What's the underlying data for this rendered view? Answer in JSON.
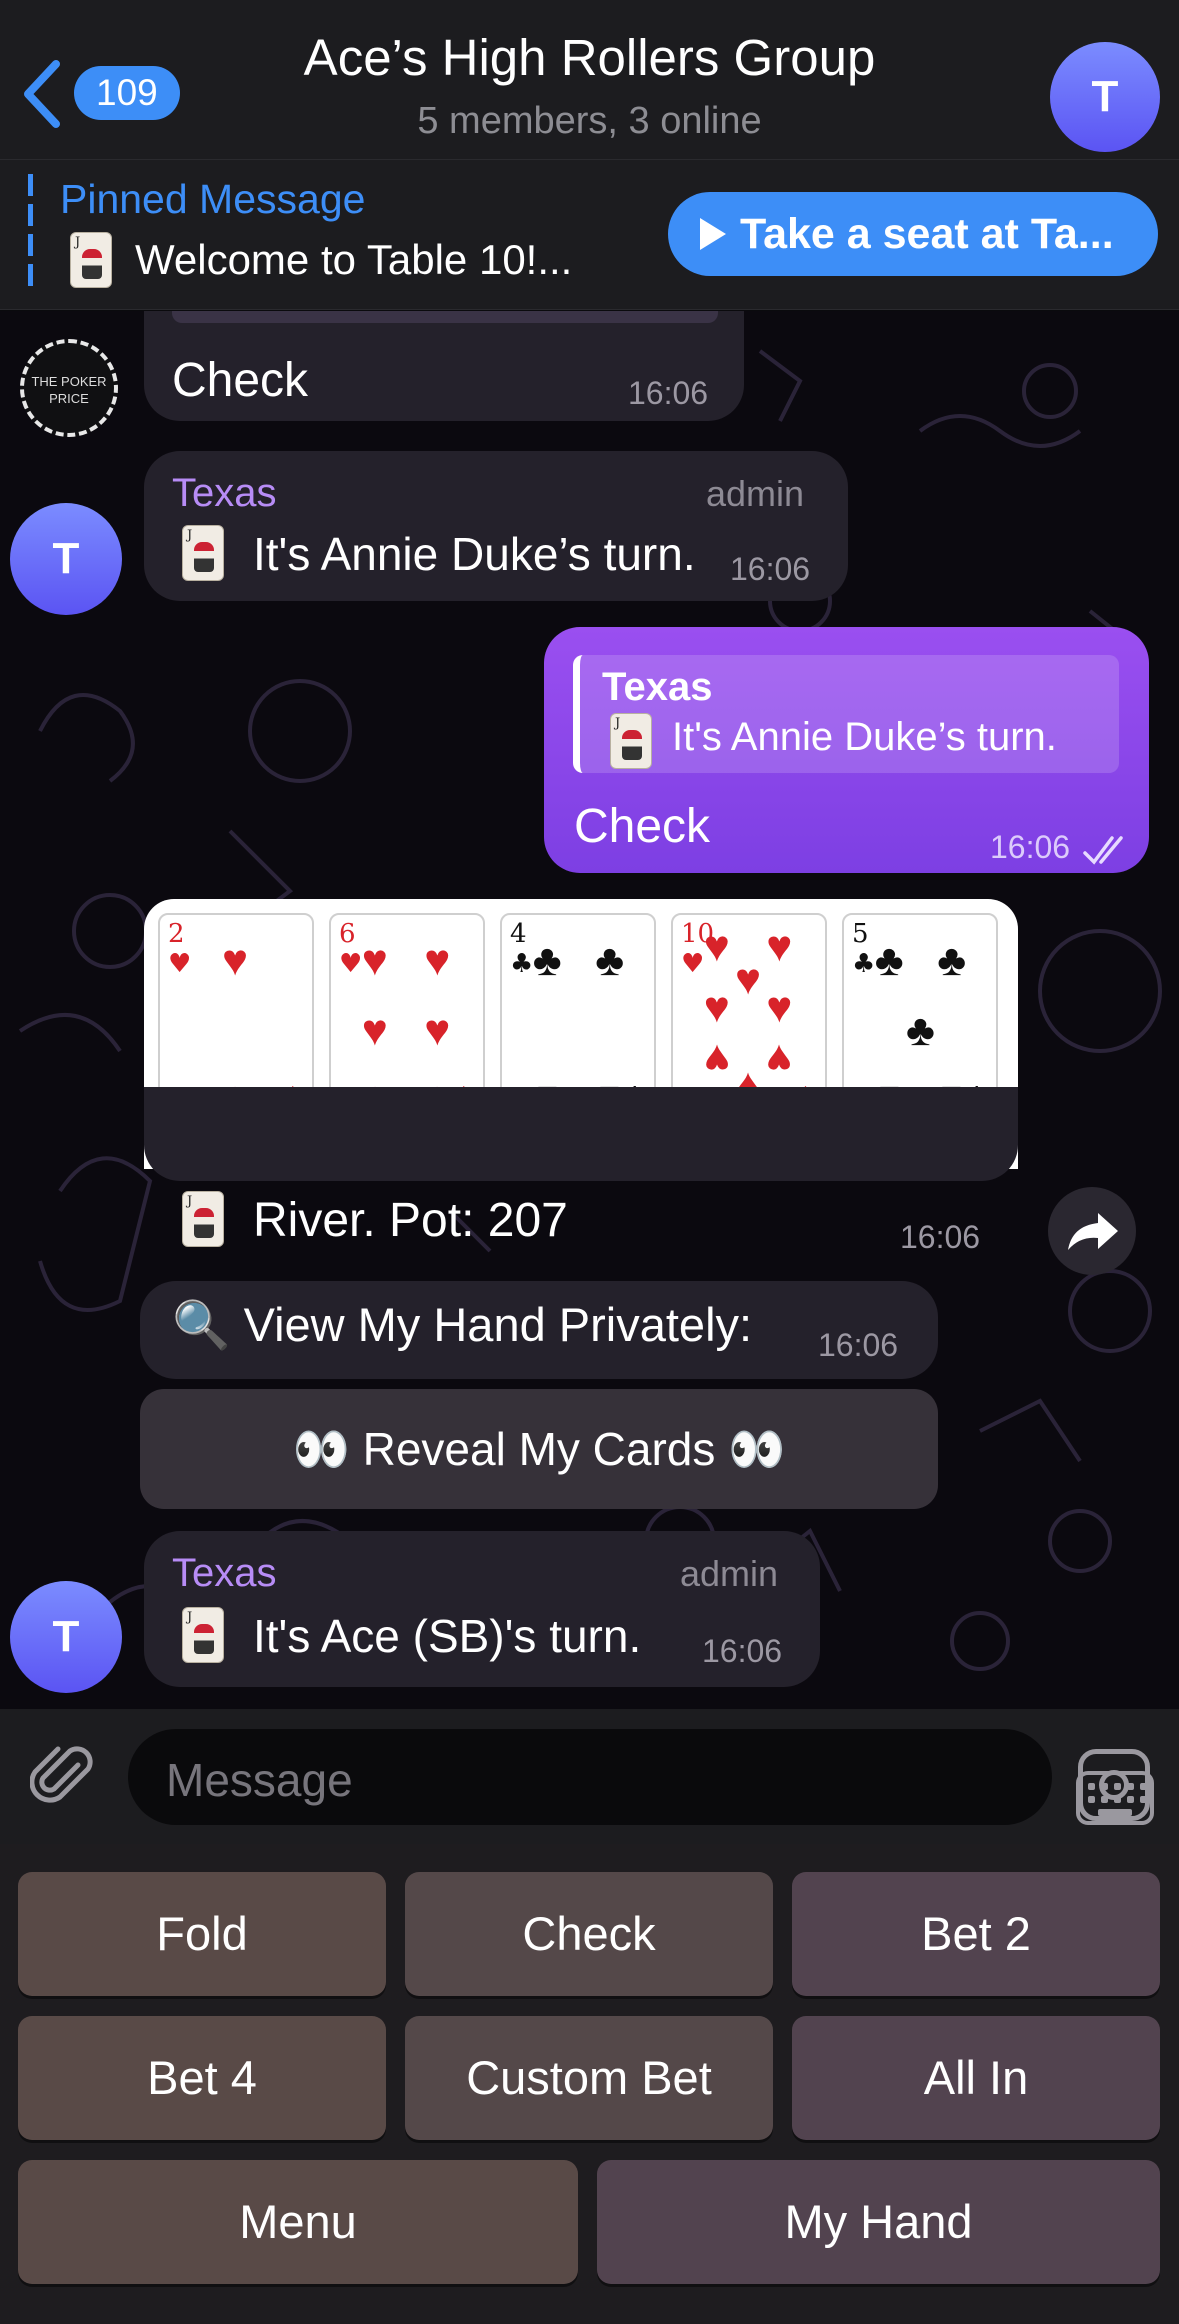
{
  "header": {
    "unread_count": "109",
    "title": "Ace’s High Rollers Group",
    "subtitle": "5 members, 3 online",
    "avatar_letter": "T"
  },
  "pinned": {
    "label": "Pinned Message",
    "text": "Welcome to Table 10!...",
    "button": "Take a seat at Ta..."
  },
  "messages": {
    "m1": {
      "text": "Check",
      "time": "16:06",
      "avatar_text": "THE POKER PRICE"
    },
    "m2": {
      "sender": "Texas",
      "role": "admin",
      "text": "It's Annie Duke’s turn.",
      "time": "16:06",
      "avatar_letter": "T"
    },
    "m3": {
      "reply_sender": "Texas",
      "reply_text": "It's Annie Duke’s turn.",
      "text": "Check",
      "time": "16:06"
    },
    "m4": {
      "cards": [
        {
          "rank": "2",
          "suit": "♥",
          "color": "red"
        },
        {
          "rank": "6",
          "suit": "♥",
          "color": "red"
        },
        {
          "rank": "4",
          "suit": "♣",
          "color": "black"
        },
        {
          "rank": "10",
          "suit": "♥",
          "color": "red"
        },
        {
          "rank": "5",
          "suit": "♣",
          "color": "black"
        }
      ],
      "text": "River. Pot: 207",
      "time": "16:06"
    },
    "m5": {
      "text": "🔍 View My Hand Privately:",
      "time": "16:06"
    },
    "m5_button": "👀 Reveal My Cards 👀",
    "m6": {
      "sender": "Texas",
      "role": "admin",
      "text": "It's  Ace (SB)'s turn.",
      "time": "16:06",
      "avatar_letter": "T"
    }
  },
  "input": {
    "placeholder": "Message"
  },
  "keyboard": {
    "row1": [
      "Fold",
      "Check",
      "Bet 2"
    ],
    "row2": [
      "Bet 4",
      "Custom Bet",
      "All In"
    ],
    "row3": [
      "Menu",
      "My Hand"
    ]
  },
  "colors": {
    "accent": "#3d8ef7",
    "outgoing": "#8b45ea",
    "sender": "#b78cf6"
  }
}
